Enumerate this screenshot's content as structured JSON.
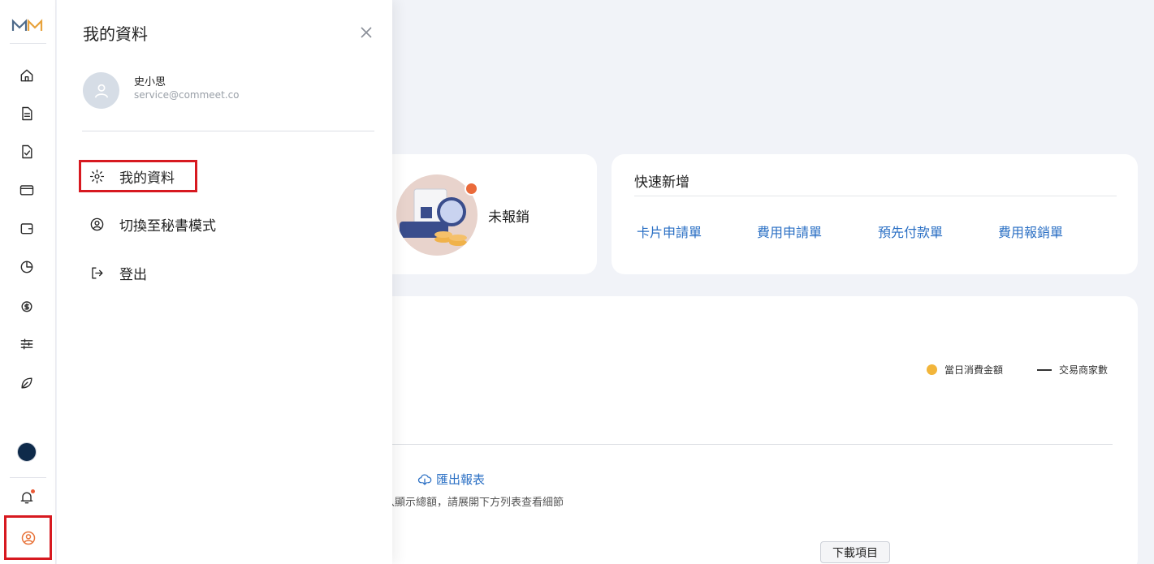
{
  "drawer": {
    "title": "我的資料",
    "user": {
      "name": "史小思",
      "email": "service@commeet.co"
    },
    "menu": [
      {
        "label": "我的資料",
        "icon": "gear-icon"
      },
      {
        "label": "切換至秘書模式",
        "icon": "user-switch-icon"
      },
      {
        "label": "登出",
        "icon": "logout-icon"
      }
    ]
  },
  "unreported": {
    "label": "未報銷"
  },
  "quick_add": {
    "title": "快速新增",
    "links": [
      "卡片申請單",
      "費用申請單",
      "預先付款單",
      "費用報銷單"
    ]
  },
  "chart_card": {
    "legend": {
      "amount": "當日消費金額",
      "merchants": "交易商家數"
    },
    "export_label": "匯出報表",
    "note": "計入顯示總額，請展開下方列表查看細節",
    "download_label": "下載項目"
  },
  "colors": {
    "accent": "#2a6fc4",
    "alert": "#d71920",
    "brand_orange": "#e8743b",
    "legend_dot": "#f2b53a"
  }
}
